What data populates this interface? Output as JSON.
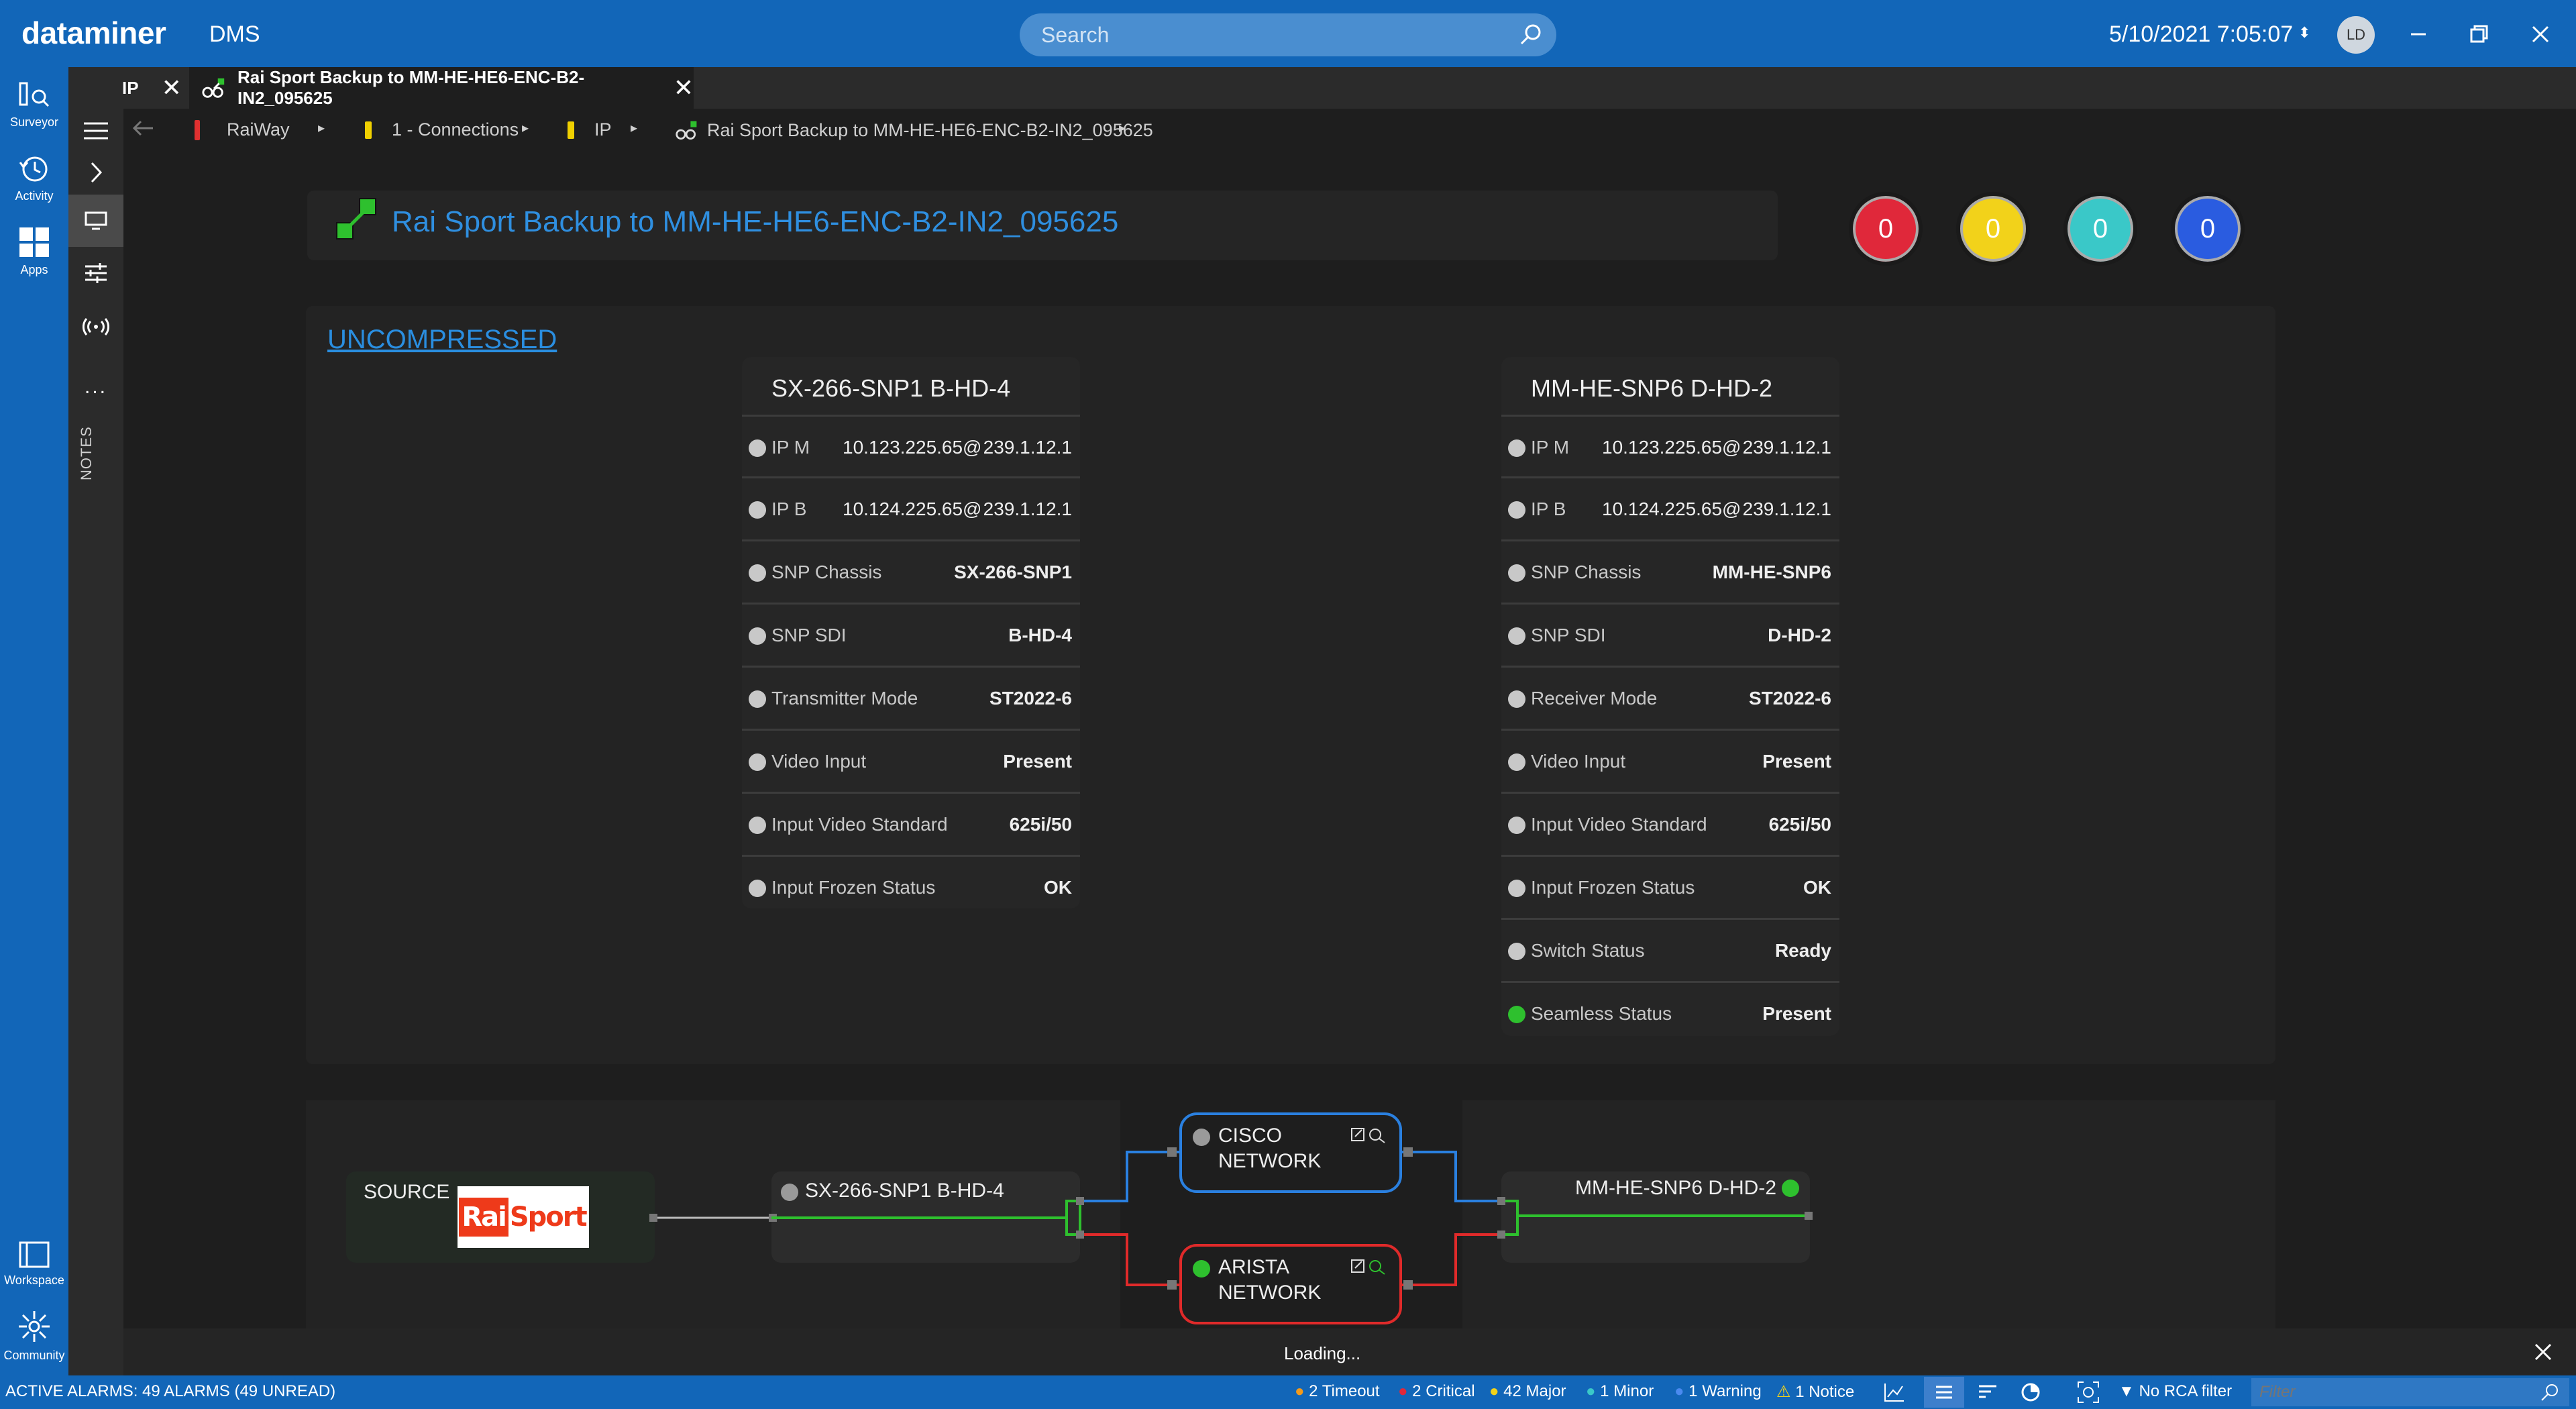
{
  "app": {
    "logo": "dataminer",
    "sub": "DMS"
  },
  "search": {
    "placeholder": "Search"
  },
  "datetime": "5/10/2021 7:05:07",
  "user": {
    "initials": "LD"
  },
  "rail": {
    "surveyor": "Surveyor",
    "activity": "Activity",
    "apps": "Apps",
    "workspace": "Workspace",
    "community": "Community"
  },
  "strip": {
    "notes": "NOTES",
    "more": "..."
  },
  "tabs": [
    {
      "label": "IP"
    },
    {
      "label": "Rai Sport Backup to MM-HE-HE6-ENC-B2-IN2_095625"
    }
  ],
  "breadcrumb": [
    "RaiWay",
    "1 - Connections",
    "IP",
    "Rai Sport Backup to MM-HE-HE6-ENC-B2-IN2_095625"
  ],
  "page": {
    "title": "Rai Sport Backup to MM-HE-HE6-ENC-B2-IN2_095625",
    "section": "UNCOMPRESSED"
  },
  "alarms": [
    {
      "value": "0",
      "color": "#e0283a"
    },
    {
      "value": "0",
      "color": "#f2d21a"
    },
    {
      "value": "0",
      "color": "#3ac8c8"
    },
    {
      "value": "0",
      "color": "#2a5ce0"
    }
  ],
  "tx_card": {
    "title": "SX-266-SNP1 B-HD-4",
    "ip_rows": [
      {
        "label": "IP M",
        "addr": "10.123.225.65@",
        "group": "239.1.12.1"
      },
      {
        "label": "IP B",
        "addr": "10.124.225.65@",
        "group": "239.1.12.1"
      }
    ],
    "rows": [
      {
        "label": "SNP Chassis",
        "value": "SX-266-SNP1"
      },
      {
        "label": "SNP SDI",
        "value": "B-HD-4"
      },
      {
        "label": "Transmitter Mode",
        "value": "ST2022-6"
      },
      {
        "label": "Video Input",
        "value": "Present"
      },
      {
        "label": "Input Video Standard",
        "value": "625i/50"
      },
      {
        "label": "Input Frozen Status",
        "value": "OK"
      }
    ]
  },
  "rx_card": {
    "title": "MM-HE-SNP6 D-HD-2",
    "ip_rows": [
      {
        "label": "IP M",
        "addr": "10.123.225.65@",
        "group": "239.1.12.1"
      },
      {
        "label": "IP B",
        "addr": "10.124.225.65@",
        "group": "239.1.12.1"
      }
    ],
    "rows": [
      {
        "label": "SNP Chassis",
        "value": "MM-HE-SNP6"
      },
      {
        "label": "SNP SDI",
        "value": "D-HD-2"
      },
      {
        "label": "Receiver Mode",
        "value": "ST2022-6"
      },
      {
        "label": "Video Input",
        "value": "Present"
      },
      {
        "label": "Input Video Standard",
        "value": "625i/50"
      },
      {
        "label": "Input Frozen Status",
        "value": "OK"
      },
      {
        "label": "Switch Status",
        "value": "Ready"
      },
      {
        "label": "Seamless Status",
        "value": "Present",
        "dot": "green"
      }
    ]
  },
  "diagram": {
    "source_label": "SOURCE",
    "source_logo": {
      "part1": "Rai",
      "part2": "Sport"
    },
    "tx_node": "SX-266-SNP1 B-HD-4",
    "rx_node": "MM-HE-SNP6 D-HD-2",
    "cisco": {
      "line1": "CISCO",
      "line2": "NETWORK"
    },
    "arista": {
      "line1": "ARISTA",
      "line2": "NETWORK"
    }
  },
  "loading": "Loading...",
  "status": {
    "active": "ACTIVE ALARMS: 49 ALARMS (49 UNREAD)",
    "timeout": "2 Timeout",
    "critical": "2 Critical",
    "major": "42 Major",
    "minor": "1 Minor",
    "warning": "1 Warning",
    "notice": "1 Notice",
    "rca": "No RCA filter",
    "filter_placeholder": "Filter"
  }
}
